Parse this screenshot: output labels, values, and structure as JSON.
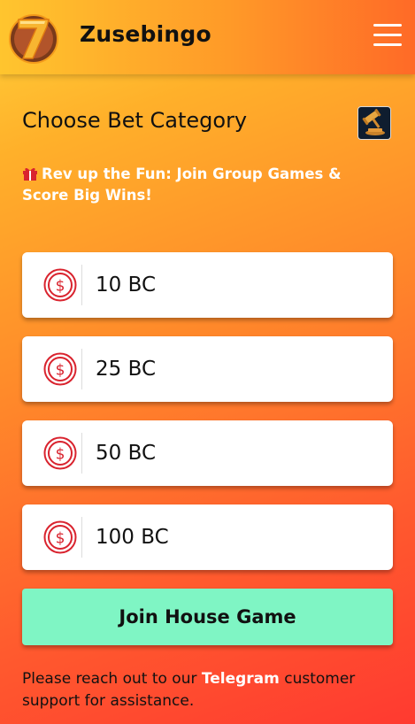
{
  "header": {
    "brand": "Zusebingo",
    "logo_icon": "seven-logo-icon",
    "menu_icon": "hamburger-menu-icon"
  },
  "main": {
    "title": "Choose Bet Category",
    "gavel_icon": "gavel-icon",
    "promo": {
      "icon": "gift-icon",
      "text": "Rev up the Fun: Join Group Games & Score Big Wins!"
    },
    "bets": [
      {
        "label": "10 BC",
        "icon": "dollar-coin-icon"
      },
      {
        "label": "25 BC",
        "icon": "dollar-coin-icon"
      },
      {
        "label": "50 BC",
        "icon": "dollar-coin-icon"
      },
      {
        "label": "100 BC",
        "icon": "dollar-coin-icon"
      }
    ],
    "join_button": "Join House Game",
    "footer": {
      "before": "Please reach out to our ",
      "link": "Telegram",
      "after": " customer support for assistance."
    }
  },
  "colors": {
    "accent_green": "#7ff5c4",
    "coin_red": "#d9232e",
    "gradient_top": "#ffd23a",
    "gradient_bottom": "#ff3a30"
  }
}
